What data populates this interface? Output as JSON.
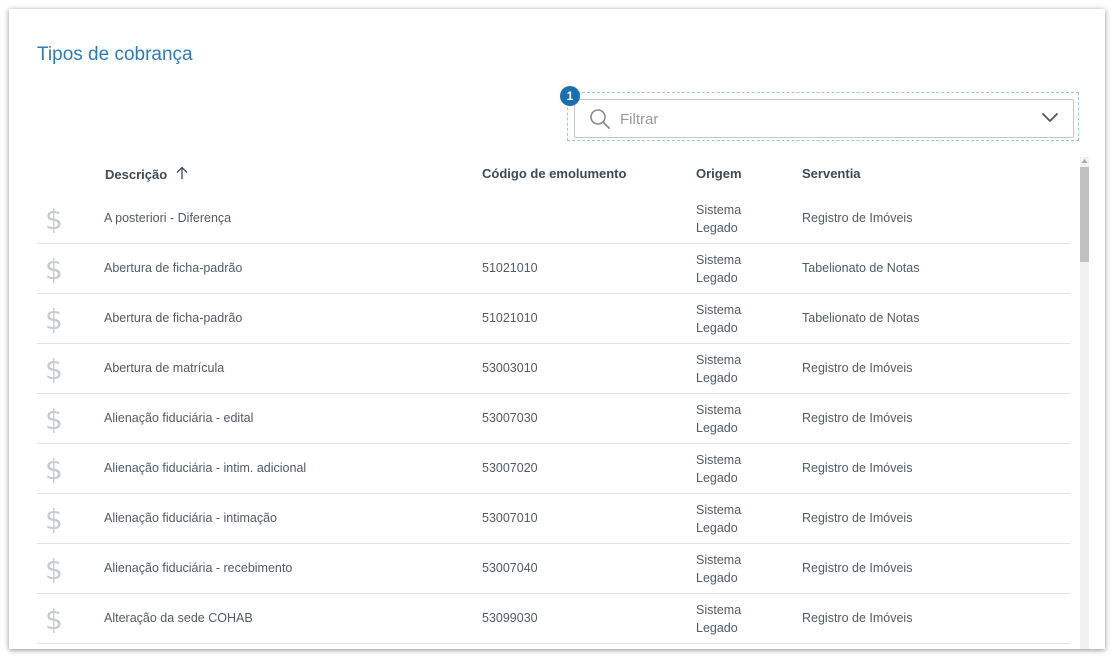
{
  "page": {
    "title": "Tipos de cobrança"
  },
  "filter": {
    "placeholder": "Filtrar",
    "value": "",
    "badge": "1"
  },
  "table": {
    "columns": {
      "descricao": "Descrição",
      "codigo": "Código de emolumento",
      "origem": "Origem",
      "serventia": "Serventia"
    },
    "sort": {
      "column": "descricao",
      "direction": "ascending"
    },
    "rows": [
      {
        "icon": "dollar-icon",
        "descricao": "A posteriori - Diferença",
        "codigo": "",
        "origem_line1": "Sistema",
        "origem_line2": "Legado",
        "serventia": "Registro de Imóveis"
      },
      {
        "icon": "dollar-icon",
        "descricao": "Abertura de ficha-padrão",
        "codigo": "51021010",
        "origem_line1": "Sistema",
        "origem_line2": "Legado",
        "serventia": "Tabelionato de Notas"
      },
      {
        "icon": "dollar-icon",
        "descricao": "Abertura de ficha-padrão",
        "codigo": "51021010",
        "origem_line1": "Sistema",
        "origem_line2": "Legado",
        "serventia": "Tabelionato de Notas"
      },
      {
        "icon": "dollar-icon",
        "descricao": "Abertura de matrícula",
        "codigo": "53003010",
        "origem_line1": "Sistema",
        "origem_line2": "Legado",
        "serventia": "Registro de Imóveis"
      },
      {
        "icon": "dollar-icon",
        "descricao": "Alienação fiduciária - edital",
        "codigo": "53007030",
        "origem_line1": "Sistema",
        "origem_line2": "Legado",
        "serventia": "Registro de Imóveis"
      },
      {
        "icon": "dollar-icon",
        "descricao": "Alienação fiduciária - intim. adicional",
        "codigo": "53007020",
        "origem_line1": "Sistema",
        "origem_line2": "Legado",
        "serventia": "Registro de Imóveis"
      },
      {
        "icon": "dollar-icon",
        "descricao": "Alienação fiduciária - intimação",
        "codigo": "53007010",
        "origem_line1": "Sistema",
        "origem_line2": "Legado",
        "serventia": "Registro de Imóveis"
      },
      {
        "icon": "dollar-icon",
        "descricao": "Alienação fiduciária - recebimento",
        "codigo": "53007040",
        "origem_line1": "Sistema",
        "origem_line2": "Legado",
        "serventia": "Registro de Imóveis"
      },
      {
        "icon": "dollar-icon",
        "descricao": "Alteração da sede COHAB",
        "codigo": "53099030",
        "origem_line1": "Sistema",
        "origem_line2": "Legado",
        "serventia": "Registro de Imóveis"
      }
    ]
  },
  "colors": {
    "title": "#2f7bb8",
    "badge": "#1a6fb0",
    "icon": "#c7ccd2"
  }
}
